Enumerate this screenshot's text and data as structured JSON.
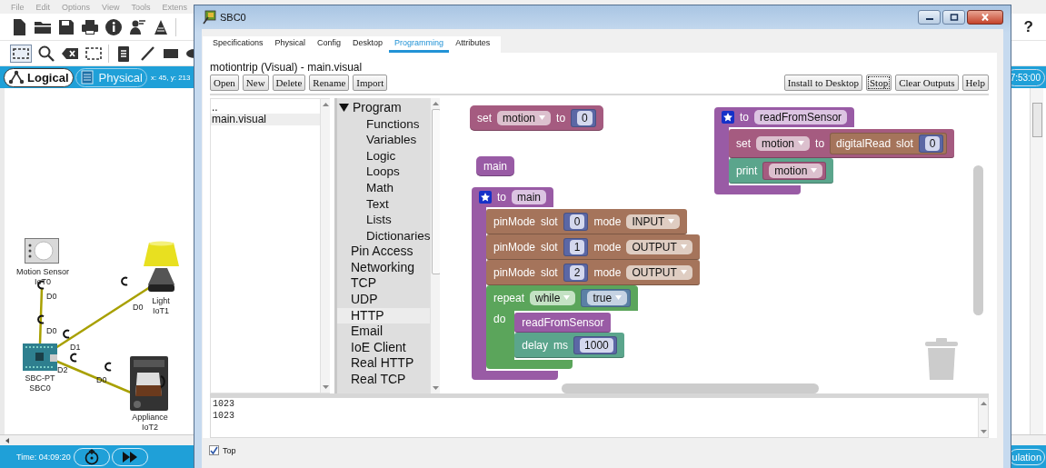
{
  "main_app": {
    "menu": [
      "File",
      "Edit",
      "Options",
      "View",
      "Tools",
      "Extens"
    ],
    "help_label": "?",
    "view_tabs": [
      {
        "label": "Logical",
        "selected": true
      },
      {
        "label": "Physical",
        "selected": false
      }
    ],
    "coordinates": "x: 45, y: 213",
    "clock": "7:53:00",
    "devices": [
      {
        "kind": "motion_sensor",
        "type": "Motion Sensor",
        "name": "IoT0"
      },
      {
        "kind": "lamp",
        "type": "Light",
        "name": "IoT1"
      },
      {
        "kind": "board",
        "type": "SBC-PT",
        "name": "SBC0"
      },
      {
        "kind": "appliance",
        "type": "Appliance",
        "name": "IoT2"
      }
    ],
    "links": [
      {
        "ports": [
          "D0",
          "D0"
        ]
      },
      {
        "ports": [
          "D1",
          "D0"
        ]
      },
      {
        "ports": [
          "D2",
          "D0"
        ]
      }
    ],
    "time": "Time: 04:09:20",
    "mode_label": "ulation"
  },
  "dialog": {
    "title": "SBC0",
    "tabs": [
      {
        "label": "Specifications",
        "selected": false
      },
      {
        "label": "Physical",
        "selected": false
      },
      {
        "label": "Config",
        "selected": false
      },
      {
        "label": "Desktop",
        "selected": false
      },
      {
        "label": "Programming",
        "selected": true
      },
      {
        "label": "Attributes",
        "selected": false
      }
    ],
    "program_title": "motiontrip (Visual) - main.visual",
    "file_buttons": [
      "Open",
      "New",
      "Delete",
      "Rename",
      "Import"
    ],
    "run_buttons": [
      {
        "label": "Install to Desktop",
        "focused": false
      },
      {
        "label": "Stop",
        "focused": true
      },
      {
        "label": "Clear Outputs",
        "focused": false
      },
      {
        "label": "Help",
        "focused": false
      }
    ],
    "files": [
      {
        "name": "..",
        "selected": false
      },
      {
        "name": "main.visual",
        "selected": true
      }
    ],
    "categories": [
      {
        "label": "Program",
        "expanded": true,
        "selected": false,
        "children": [
          {
            "label": "Functions",
            "selected": false
          },
          {
            "label": "Variables",
            "selected": false
          },
          {
            "label": "Logic",
            "selected": false
          },
          {
            "label": "Loops",
            "selected": false
          },
          {
            "label": "Math",
            "selected": false
          },
          {
            "label": "Text",
            "selected": false
          },
          {
            "label": "Lists",
            "selected": false
          },
          {
            "label": "Dictionaries",
            "selected": false
          }
        ]
      },
      {
        "label": "Pin Access",
        "selected": false
      },
      {
        "label": "Networking",
        "selected": false
      },
      {
        "label": "TCP",
        "selected": false
      },
      {
        "label": "UDP",
        "selected": false
      },
      {
        "label": "HTTP",
        "selected": true
      },
      {
        "label": "Email",
        "selected": false
      },
      {
        "label": "IoE Client",
        "selected": false
      },
      {
        "label": "Real HTTP",
        "selected": false
      },
      {
        "label": "Real TCP",
        "selected": false
      }
    ],
    "workspace": {
      "stacks": [
        {
          "kind": "variables",
          "parts": [
            {
              "kind": "label",
              "text": "set"
            },
            {
              "kind": "dropdown",
              "text": "motion"
            },
            {
              "kind": "label",
              "text": "to"
            },
            {
              "kind": "input",
              "block": {
                "kind": "math",
                "parts": [
                  {
                    "kind": "number",
                    "text": "0"
                  }
                ]
              }
            }
          ]
        },
        {
          "kind": "procedures",
          "parts": [
            {
              "kind": "label",
              "text": "main"
            }
          ]
        },
        {
          "kind": "define",
          "parts": [
            {
              "kind": "label",
              "text": "to"
            },
            {
              "kind": "field",
              "text": "main"
            }
          ],
          "children": [
            {
              "kind": "pins",
              "parts": [
                {
                  "kind": "label",
                  "text": "pinMode"
                },
                {
                  "kind": "label",
                  "text": "slot"
                },
                {
                  "kind": "input",
                  "block": {
                    "kind": "math",
                    "parts": [
                      {
                        "kind": "number",
                        "text": "0"
                      }
                    ]
                  }
                },
                {
                  "kind": "label",
                  "text": "mode"
                },
                {
                  "kind": "dropdown",
                  "text": "INPUT"
                }
              ]
            },
            {
              "kind": "pins",
              "parts": [
                {
                  "kind": "label",
                  "text": "pinMode"
                },
                {
                  "kind": "label",
                  "text": "slot"
                },
                {
                  "kind": "input",
                  "block": {
                    "kind": "math",
                    "parts": [
                      {
                        "kind": "number",
                        "text": "1"
                      }
                    ]
                  }
                },
                {
                  "kind": "label",
                  "text": "mode"
                },
                {
                  "kind": "dropdown",
                  "text": "OUTPUT"
                }
              ]
            },
            {
              "kind": "pins",
              "parts": [
                {
                  "kind": "label",
                  "text": "pinMode"
                },
                {
                  "kind": "label",
                  "text": "slot"
                },
                {
                  "kind": "input",
                  "block": {
                    "kind": "math",
                    "parts": [
                      {
                        "kind": "number",
                        "text": "2"
                      }
                    ]
                  }
                },
                {
                  "kind": "label",
                  "text": "mode"
                },
                {
                  "kind": "dropdown",
                  "text": "OUTPUT"
                }
              ]
            },
            {
              "kind": "loops",
              "parts": [
                {
                  "kind": "label",
                  "text": "repeat"
                },
                {
                  "kind": "dropdown",
                  "text": "while"
                },
                {
                  "kind": "input",
                  "block": {
                    "kind": "logic",
                    "parts": [
                      {
                        "kind": "dropdown",
                        "text": "true"
                      }
                    ]
                  }
                }
              ],
              "body_label": "do",
              "children": [
                {
                  "kind": "procedures",
                  "parts": [
                    {
                      "kind": "label",
                      "text": "readFromSensor"
                    }
                  ]
                },
                {
                  "kind": "basic",
                  "parts": [
                    {
                      "kind": "label",
                      "text": "delay"
                    },
                    {
                      "kind": "label",
                      "text": "ms"
                    },
                    {
                      "kind": "input",
                      "block": {
                        "kind": "math",
                        "parts": [
                          {
                            "kind": "number",
                            "text": "1000"
                          }
                        ]
                      }
                    }
                  ]
                }
              ]
            }
          ]
        },
        {
          "kind": "define",
          "parts": [
            {
              "kind": "label",
              "text": "to"
            },
            {
              "kind": "field",
              "text": "readFromSensor"
            }
          ],
          "children": [
            {
              "kind": "variables",
              "parts": [
                {
                  "kind": "label",
                  "text": "set"
                },
                {
                  "kind": "dropdown",
                  "text": "motion"
                },
                {
                  "kind": "label",
                  "text": "to"
                },
                {
                  "kind": "input",
                  "block": {
                    "kind": "pins",
                    "parts": [
                      {
                        "kind": "label",
                        "text": "digitalRead"
                      },
                      {
                        "kind": "label",
                        "text": "slot"
                      },
                      {
                        "kind": "input",
                        "block": {
                          "kind": "math",
                          "parts": [
                            {
                              "kind": "number",
                              "text": "0"
                            }
                          ]
                        }
                      }
                    ]
                  }
                }
              ]
            },
            {
              "kind": "basic",
              "parts": [
                {
                  "kind": "label",
                  "text": "print"
                },
                {
                  "kind": "input",
                  "block": {
                    "kind": "variables",
                    "parts": [
                      {
                        "kind": "dropdown",
                        "text": "motion"
                      }
                    ]
                  }
                }
              ]
            }
          ]
        }
      ]
    },
    "output": [
      "1023",
      "1023"
    ],
    "top_checkbox": {
      "label": "Top",
      "checked": true
    }
  }
}
